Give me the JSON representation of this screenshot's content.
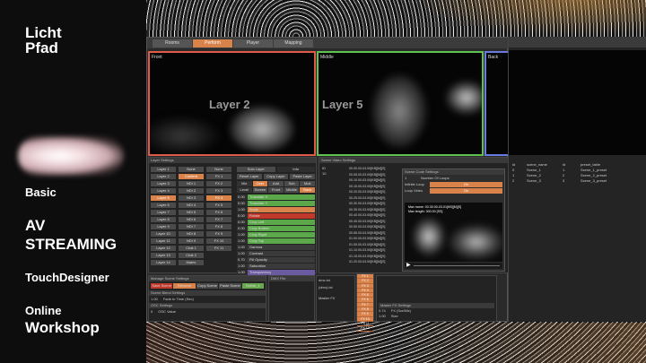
{
  "brand": {
    "line1": "Licht",
    "line2": "Pfad"
  },
  "left_text": {
    "basic": "Basic",
    "av1": "AV",
    "av2": "STREAMING",
    "td": "TouchDesigner",
    "online": "Online",
    "workshop": "Workshop"
  },
  "tabs": [
    {
      "label": "Rooms",
      "active": false
    },
    {
      "label": "Perform",
      "active": true
    },
    {
      "label": "Player",
      "active": false
    },
    {
      "label": "Mapping",
      "active": false
    }
  ],
  "views": [
    {
      "label": "Front",
      "layer_text": "Layer 2",
      "border": "#e05a4a"
    },
    {
      "label": "Middle",
      "layer_text": "Layer 5",
      "border": "#5ec34f"
    },
    {
      "label": "Back",
      "border": "#6a7ae0"
    }
  ],
  "layer_settings": {
    "title": "Layer Settings",
    "col1": [
      "Layer 1",
      "Layer 2",
      "Layer 3",
      "Layer 4",
      "Layer 5",
      "Layer 6",
      "Layer 7",
      "Layer 8",
      "Layer 9",
      "Layer 10",
      "Layer 11",
      "Layer 12",
      "Layer 13",
      "Layer 14"
    ],
    "col2": [
      "None",
      "Content",
      "NDI 1",
      "NDI 2",
      "NDI 3",
      "NDI 4",
      "NDI 5",
      "NDI 6",
      "NDI 7",
      "NDI 8",
      "NDI 9",
      "Chat 1",
      "Chat 2",
      "Matrix"
    ],
    "col3": [
      "None",
      "FX 1",
      "FX 2",
      "FX 3",
      "FX 4",
      "FX 5",
      "FX 6",
      "FX 7",
      "FX 8",
      "FX 9",
      "FX 10",
      "FX 11"
    ],
    "selected": "Layer 5",
    "selected2": "Content",
    "selected3": "FX 4",
    "solo_label": "Solo Layer",
    "solo_value": "Info",
    "buttons": [
      "Reset Layer",
      "Copy Layer",
      "Paste Layer"
    ],
    "blend_row": [
      "Mix",
      "Over",
      "Add",
      "Sub",
      "Mult"
    ],
    "blend_row2": [
      "Level",
      "Screen",
      "Front",
      "Middle",
      "Back"
    ],
    "params": [
      "Translate X",
      "Translate Y",
      "Scale",
      "Rotate",
      "Crop Left",
      "Crop Bottom",
      "Crop Right",
      "Crop Top",
      "Gamma",
      "Contrast",
      "Fill Opacity",
      "Saturation",
      "Transparency"
    ],
    "param_values": [
      "0.00",
      "0.00",
      "1.00",
      "0.00",
      "0.00",
      "0.00",
      "1.00",
      "1.00",
      "1.00",
      "1.00",
      "0.70",
      "1.00",
      "1.00"
    ]
  },
  "scene_video": {
    "title": "Scene Video Settings",
    "ids": [
      "ID",
      "10"
    ],
    "timecodes": [
      "00.00.00-03.00[KB][M][S]",
      "00.05.00-03.00[KB][M][S]",
      "00.10.00-03.00[KB][M][S]",
      "00.15.00-03.00[KB][M][S]",
      "00.20.00-03.00[KB][M][S]",
      "00.25.00-03.00[KB][M][S]",
      "00.30.00-03.00[KB][M][S]",
      "00.35.00-03.00[KB][M][S]",
      "00.40.00-03.00[KB][M][S]",
      "00.45.00-03.00[KB][M][S]",
      "00.50.00-03.00[KB][M][S]",
      "00.55.00-03.00[KB][M][S]",
      "01.00.00-03.00[KB][M][S]",
      "01.05.00-03.00[KB][M][S]",
      "01.10.00-03.00[KB][M][S]",
      "01.15.00-03.00[KB][M][S]",
      "01.20.00-03.00[KB][M][S]"
    ]
  },
  "scene_code": {
    "title": "Scene Code Settings",
    "rows": [
      "Number Of Loops",
      "Infinite Loop",
      "Loop Video"
    ],
    "values": [
      "1",
      "On",
      "On"
    ],
    "max_name": "Max name:",
    "max_length": "Max length:",
    "name_val": "03.30.00-03.01[KB][M][S]",
    "length_val": "300.00 [SS]"
  },
  "right_panel": {
    "headers": [
      "id",
      "scene_name",
      "id",
      "preset_table"
    ],
    "rows": [
      [
        "0",
        "Scene_1",
        "1",
        "Scene_1_preset"
      ],
      [
        "1",
        "Scene_2",
        "2",
        "Scene_2_preset"
      ],
      [
        "2",
        "Scene_3",
        "3",
        "Scene_3_preset"
      ]
    ]
  },
  "bottom": {
    "manage_title": "Manage Scene Settings",
    "manage_buttons": [
      "Save Scene",
      "Rename",
      "Copy Scene",
      "Paste Scene",
      "Scene_1"
    ],
    "blend_title": "Scene Blend Settings",
    "blend_row": [
      "1.00",
      "Fade In Time (Sec)"
    ],
    "osc_title": "OSC Settings",
    "osc_row": [
      "0",
      "OSC Value"
    ],
    "dmx_title": "DMX File",
    "dmx_files": [
      "dmx.txt",
      "(dmx).txt"
    ],
    "master_title": "Master FX",
    "fx_list": [
      "FX 1",
      "FX 2",
      "FX 3",
      "FX 4",
      "FX 5",
      "FX 6",
      "FX 7",
      "FX 8",
      "FX 9",
      "FX 10",
      "FX 11",
      "FX 12"
    ],
    "master_fx_settings": "Master FX Settings",
    "master_fx_value": "0.74",
    "master_fx_label": "FX (Scr/Mix)",
    "master_fx_value2": "1.00",
    "master_fx_label2": "Size"
  }
}
